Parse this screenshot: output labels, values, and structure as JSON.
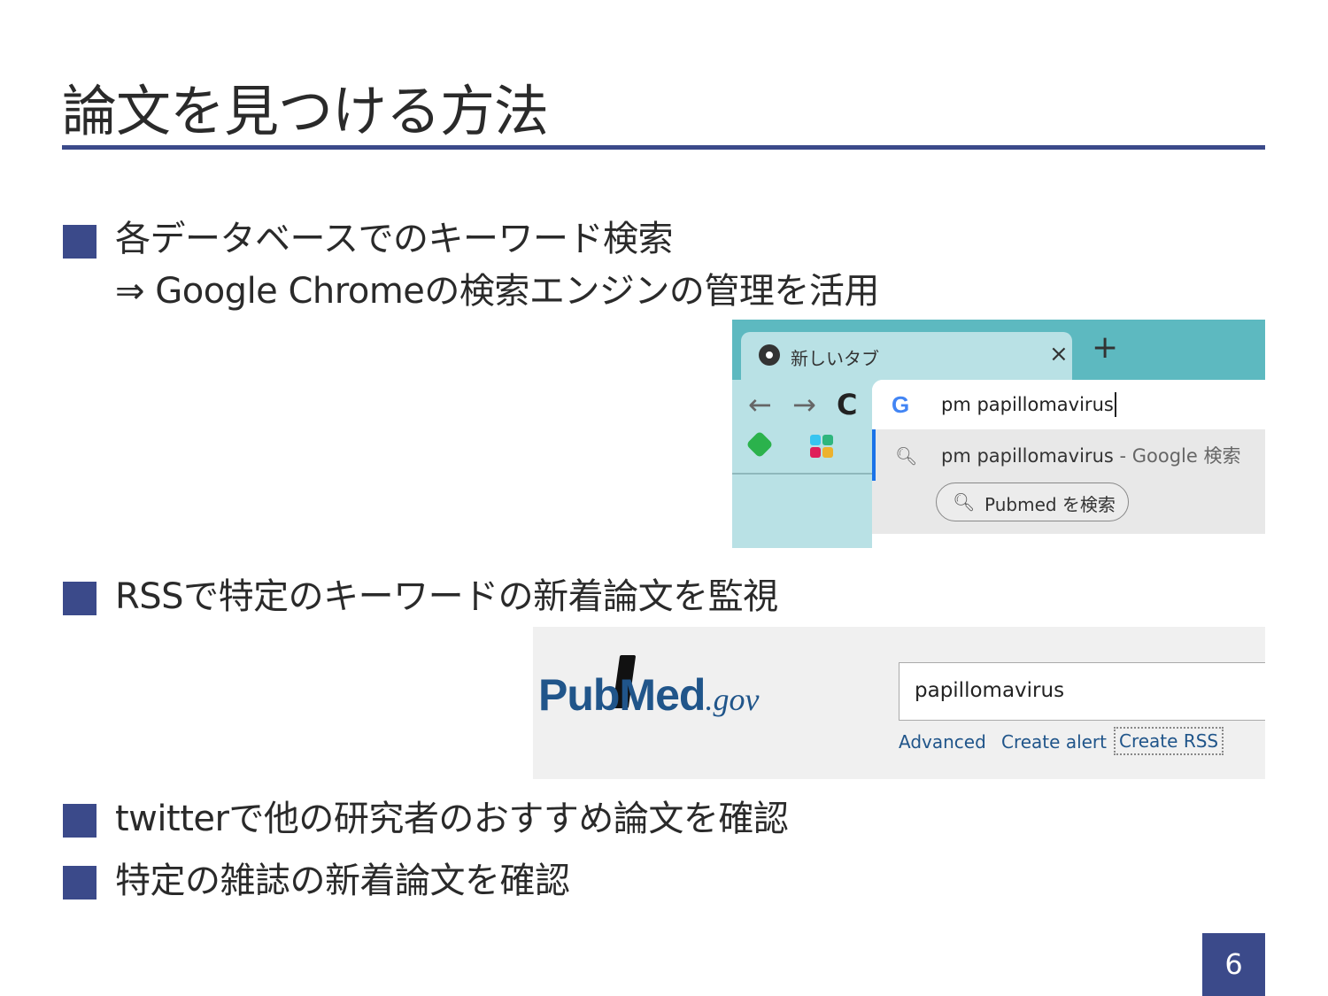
{
  "slide": {
    "title": "論文を見つける方法",
    "page_number": "6",
    "accent_color": "#3b4a8a"
  },
  "bullets": [
    {
      "text": "各データベースでのキーワード検索",
      "subtext": "⇒ Google Chromeの検索エンジンの管理を活用"
    },
    {
      "text": "RSSで特定のキーワードの新着論文を監視"
    },
    {
      "text": "twitterで他の研究者のおすすめ論文を確認"
    },
    {
      "text": "特定の雑誌の新着論文を確認"
    }
  ],
  "chrome_screenshot": {
    "tab_title": "新しいタブ",
    "tab_close": "×",
    "new_tab": "+",
    "nav_back": "←",
    "nav_forward": "→",
    "nav_reload": "C",
    "omnibox_g": "G",
    "omnibox_query": "pm papillomavirus",
    "suggestion_query": "pm papillomavirus",
    "suggestion_hint": " - Google 検索",
    "search_chip": "Pubmed を検索",
    "search_icon": "search-icon"
  },
  "pubmed_screenshot": {
    "logo_word": "PubMed",
    "logo_suffix": ".gov",
    "search_value": "papillomavirus",
    "links": [
      "Advanced",
      "Create alert",
      "Create RSS"
    ]
  }
}
